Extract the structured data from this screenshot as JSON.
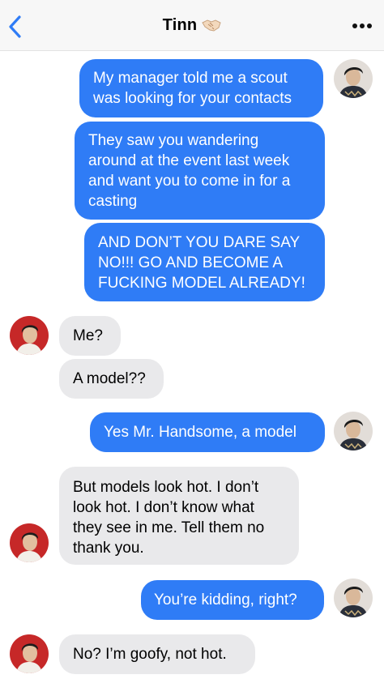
{
  "header": {
    "title": "Tinn",
    "title_emoji": "handshake-emoji",
    "back_icon": "chevron-left-icon",
    "more_icon": "more-dots-icon",
    "accent_color": "#2f7cf6"
  },
  "colors": {
    "sent_bubble": "#2f7cf6",
    "received_bubble": "#e9e9eb",
    "header_bg": "#f7f7f7"
  },
  "messages": [
    {
      "sender": "me",
      "lines": [
        "My manager told me a scout",
        "was looking for your contacts"
      ]
    },
    {
      "sender": "me",
      "lines": [
        "They saw you wandering",
        "around at the event last week",
        "and want you to come in for a",
        "casting"
      ]
    },
    {
      "sender": "me",
      "lines": [
        "AND DON’T YOU DARE SAY",
        "NO!!! GO AND BECOME A",
        "FUCKING MODEL ALREADY!"
      ]
    },
    {
      "sender": "them",
      "lines": [
        "Me?"
      ]
    },
    {
      "sender": "them",
      "lines": [
        "A model??"
      ]
    },
    {
      "sender": "me",
      "lines": [
        "Yes Mr. Handsome, a model"
      ]
    },
    {
      "sender": "them",
      "lines": [
        "But models look hot. I don’t",
        "look hot. I don’t know what",
        "they see in me. Tell them no",
        "thank you."
      ]
    },
    {
      "sender": "me",
      "lines": [
        "You’re kidding, right?"
      ]
    },
    {
      "sender": "them",
      "lines": [
        "No? I’m goofy, not hot."
      ]
    }
  ]
}
